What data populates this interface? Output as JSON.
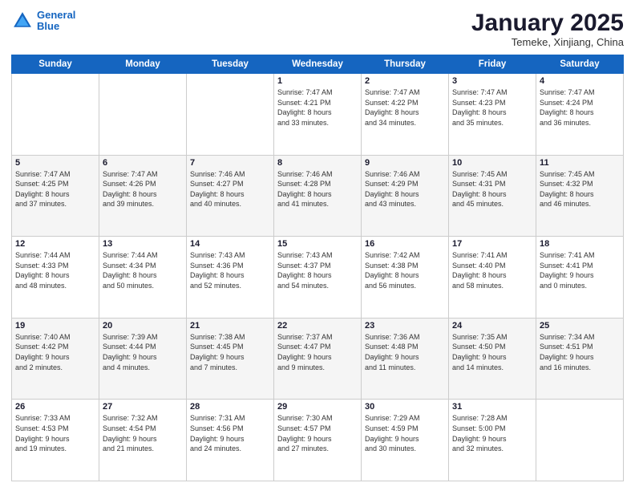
{
  "header": {
    "logo_line1": "General",
    "logo_line2": "Blue",
    "month": "January 2025",
    "location": "Temeke, Xinjiang, China"
  },
  "days_of_week": [
    "Sunday",
    "Monday",
    "Tuesday",
    "Wednesday",
    "Thursday",
    "Friday",
    "Saturday"
  ],
  "weeks": [
    [
      {
        "day": "",
        "info": ""
      },
      {
        "day": "",
        "info": ""
      },
      {
        "day": "",
        "info": ""
      },
      {
        "day": "1",
        "info": "Sunrise: 7:47 AM\nSunset: 4:21 PM\nDaylight: 8 hours\nand 33 minutes."
      },
      {
        "day": "2",
        "info": "Sunrise: 7:47 AM\nSunset: 4:22 PM\nDaylight: 8 hours\nand 34 minutes."
      },
      {
        "day": "3",
        "info": "Sunrise: 7:47 AM\nSunset: 4:23 PM\nDaylight: 8 hours\nand 35 minutes."
      },
      {
        "day": "4",
        "info": "Sunrise: 7:47 AM\nSunset: 4:24 PM\nDaylight: 8 hours\nand 36 minutes."
      }
    ],
    [
      {
        "day": "5",
        "info": "Sunrise: 7:47 AM\nSunset: 4:25 PM\nDaylight: 8 hours\nand 37 minutes."
      },
      {
        "day": "6",
        "info": "Sunrise: 7:47 AM\nSunset: 4:26 PM\nDaylight: 8 hours\nand 39 minutes."
      },
      {
        "day": "7",
        "info": "Sunrise: 7:46 AM\nSunset: 4:27 PM\nDaylight: 8 hours\nand 40 minutes."
      },
      {
        "day": "8",
        "info": "Sunrise: 7:46 AM\nSunset: 4:28 PM\nDaylight: 8 hours\nand 41 minutes."
      },
      {
        "day": "9",
        "info": "Sunrise: 7:46 AM\nSunset: 4:29 PM\nDaylight: 8 hours\nand 43 minutes."
      },
      {
        "day": "10",
        "info": "Sunrise: 7:45 AM\nSunset: 4:31 PM\nDaylight: 8 hours\nand 45 minutes."
      },
      {
        "day": "11",
        "info": "Sunrise: 7:45 AM\nSunset: 4:32 PM\nDaylight: 8 hours\nand 46 minutes."
      }
    ],
    [
      {
        "day": "12",
        "info": "Sunrise: 7:44 AM\nSunset: 4:33 PM\nDaylight: 8 hours\nand 48 minutes."
      },
      {
        "day": "13",
        "info": "Sunrise: 7:44 AM\nSunset: 4:34 PM\nDaylight: 8 hours\nand 50 minutes."
      },
      {
        "day": "14",
        "info": "Sunrise: 7:43 AM\nSunset: 4:36 PM\nDaylight: 8 hours\nand 52 minutes."
      },
      {
        "day": "15",
        "info": "Sunrise: 7:43 AM\nSunset: 4:37 PM\nDaylight: 8 hours\nand 54 minutes."
      },
      {
        "day": "16",
        "info": "Sunrise: 7:42 AM\nSunset: 4:38 PM\nDaylight: 8 hours\nand 56 minutes."
      },
      {
        "day": "17",
        "info": "Sunrise: 7:41 AM\nSunset: 4:40 PM\nDaylight: 8 hours\nand 58 minutes."
      },
      {
        "day": "18",
        "info": "Sunrise: 7:41 AM\nSunset: 4:41 PM\nDaylight: 9 hours\nand 0 minutes."
      }
    ],
    [
      {
        "day": "19",
        "info": "Sunrise: 7:40 AM\nSunset: 4:42 PM\nDaylight: 9 hours\nand 2 minutes."
      },
      {
        "day": "20",
        "info": "Sunrise: 7:39 AM\nSunset: 4:44 PM\nDaylight: 9 hours\nand 4 minutes."
      },
      {
        "day": "21",
        "info": "Sunrise: 7:38 AM\nSunset: 4:45 PM\nDaylight: 9 hours\nand 7 minutes."
      },
      {
        "day": "22",
        "info": "Sunrise: 7:37 AM\nSunset: 4:47 PM\nDaylight: 9 hours\nand 9 minutes."
      },
      {
        "day": "23",
        "info": "Sunrise: 7:36 AM\nSunset: 4:48 PM\nDaylight: 9 hours\nand 11 minutes."
      },
      {
        "day": "24",
        "info": "Sunrise: 7:35 AM\nSunset: 4:50 PM\nDaylight: 9 hours\nand 14 minutes."
      },
      {
        "day": "25",
        "info": "Sunrise: 7:34 AM\nSunset: 4:51 PM\nDaylight: 9 hours\nand 16 minutes."
      }
    ],
    [
      {
        "day": "26",
        "info": "Sunrise: 7:33 AM\nSunset: 4:53 PM\nDaylight: 9 hours\nand 19 minutes."
      },
      {
        "day": "27",
        "info": "Sunrise: 7:32 AM\nSunset: 4:54 PM\nDaylight: 9 hours\nand 21 minutes."
      },
      {
        "day": "28",
        "info": "Sunrise: 7:31 AM\nSunset: 4:56 PM\nDaylight: 9 hours\nand 24 minutes."
      },
      {
        "day": "29",
        "info": "Sunrise: 7:30 AM\nSunset: 4:57 PM\nDaylight: 9 hours\nand 27 minutes."
      },
      {
        "day": "30",
        "info": "Sunrise: 7:29 AM\nSunset: 4:59 PM\nDaylight: 9 hours\nand 30 minutes."
      },
      {
        "day": "31",
        "info": "Sunrise: 7:28 AM\nSunset: 5:00 PM\nDaylight: 9 hours\nand 32 minutes."
      },
      {
        "day": "",
        "info": ""
      }
    ]
  ]
}
